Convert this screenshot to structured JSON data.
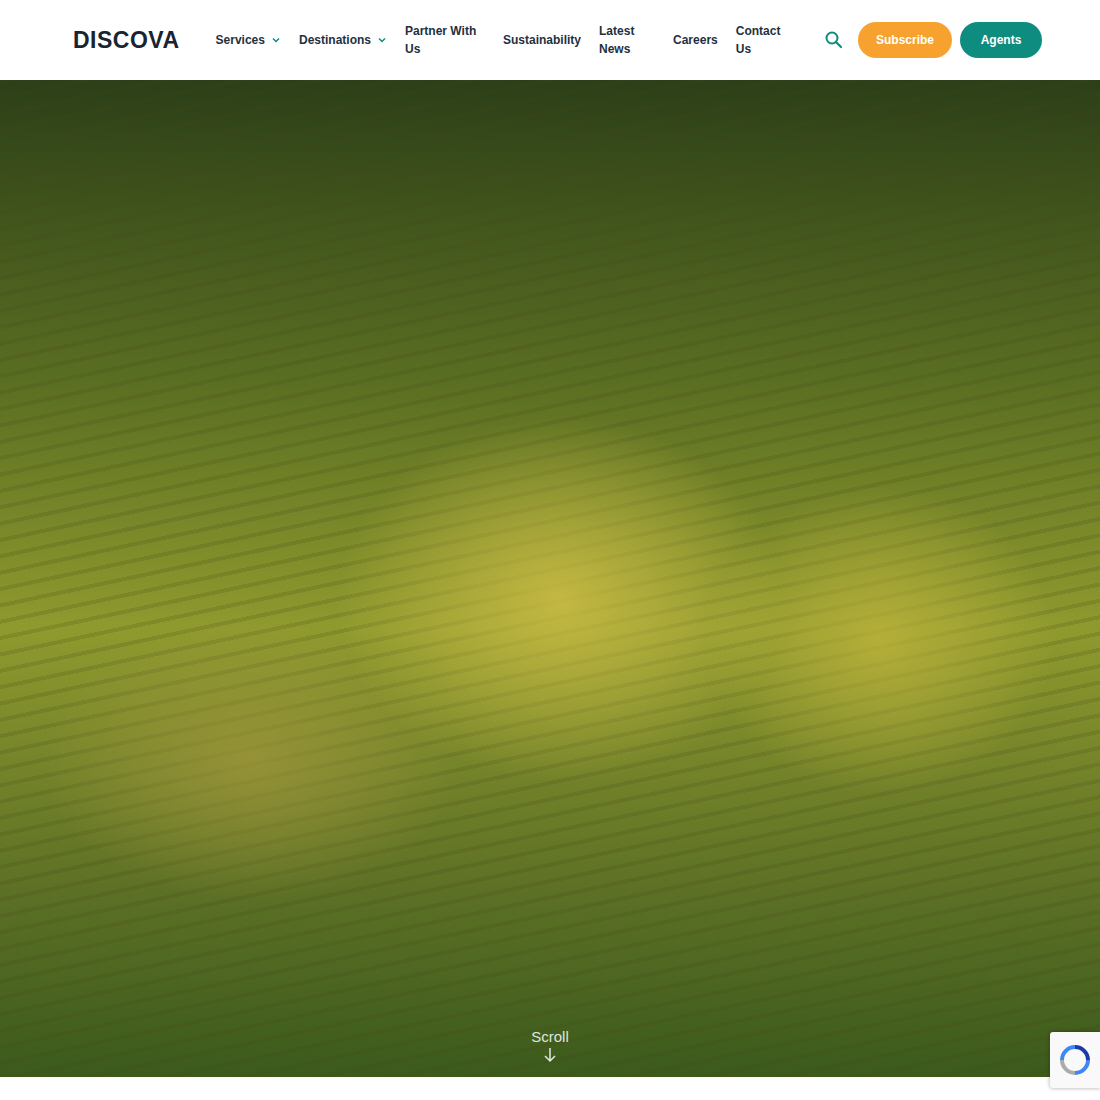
{
  "logo": "DISCOVA",
  "nav": [
    {
      "label": "Services",
      "kind": "menu"
    },
    {
      "label": "Destinations",
      "kind": "menu"
    },
    {
      "label": "Partner With Us",
      "kind": "link"
    },
    {
      "label": "Sustainability",
      "kind": "link"
    },
    {
      "label": "Latest News",
      "kind": "link"
    },
    {
      "label": "Careers",
      "kind": "link"
    },
    {
      "label": "Contact Us",
      "kind": "link"
    }
  ],
  "buttons": [
    "Subscribe",
    "Agents"
  ],
  "hero": {
    "scroll": "Scroll"
  }
}
